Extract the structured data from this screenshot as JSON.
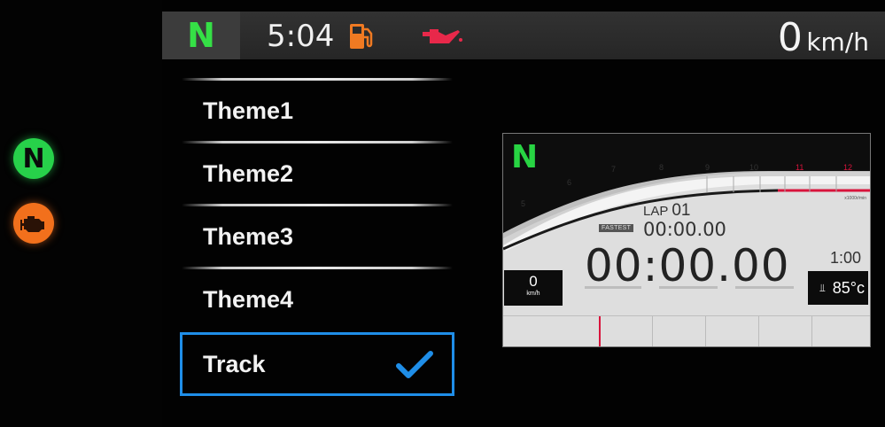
{
  "indicators": {
    "neutral_label": "N",
    "neutral_icon": "neutral-indicator-icon",
    "engine_icon": "check-engine-icon",
    "neutral_color": "#27d14a",
    "engine_color": "#f2701c"
  },
  "status_bar": {
    "gear": "N",
    "time": "5:04",
    "fuel_icon": "fuel-pump-icon",
    "oil_icon": "oil-pressure-icon",
    "speed_value": "0",
    "speed_unit": "km/h",
    "gear_color": "#35e046",
    "fuel_icon_color": "#f07a22",
    "oil_icon_color": "#e8284a"
  },
  "menu": {
    "items": [
      {
        "label": "Theme1",
        "selected": false
      },
      {
        "label": "Theme2",
        "selected": false
      },
      {
        "label": "Theme3",
        "selected": false
      },
      {
        "label": "Theme4",
        "selected": false
      },
      {
        "label": "Track",
        "selected": true
      }
    ],
    "selected_icon": "checkmark-icon",
    "accent_color": "#1f8ee8"
  },
  "preview": {
    "gear": "N",
    "rpm_ticks": [
      "5",
      "6",
      "7",
      "8",
      "9",
      "10",
      "11",
      "12"
    ],
    "rpm_unit": "x1000r/min",
    "lap_label": "LAP",
    "lap_number": "01",
    "fastest_badge": "FASTEST",
    "fastest_time": "00:00.00",
    "lap_time": "00:00.00",
    "speed_value": "0",
    "speed_unit": "km/h",
    "clock": "1:00",
    "temp_icon": "coolant-temp-icon",
    "temperature": "85°c",
    "redline_color": "#d8143c"
  }
}
